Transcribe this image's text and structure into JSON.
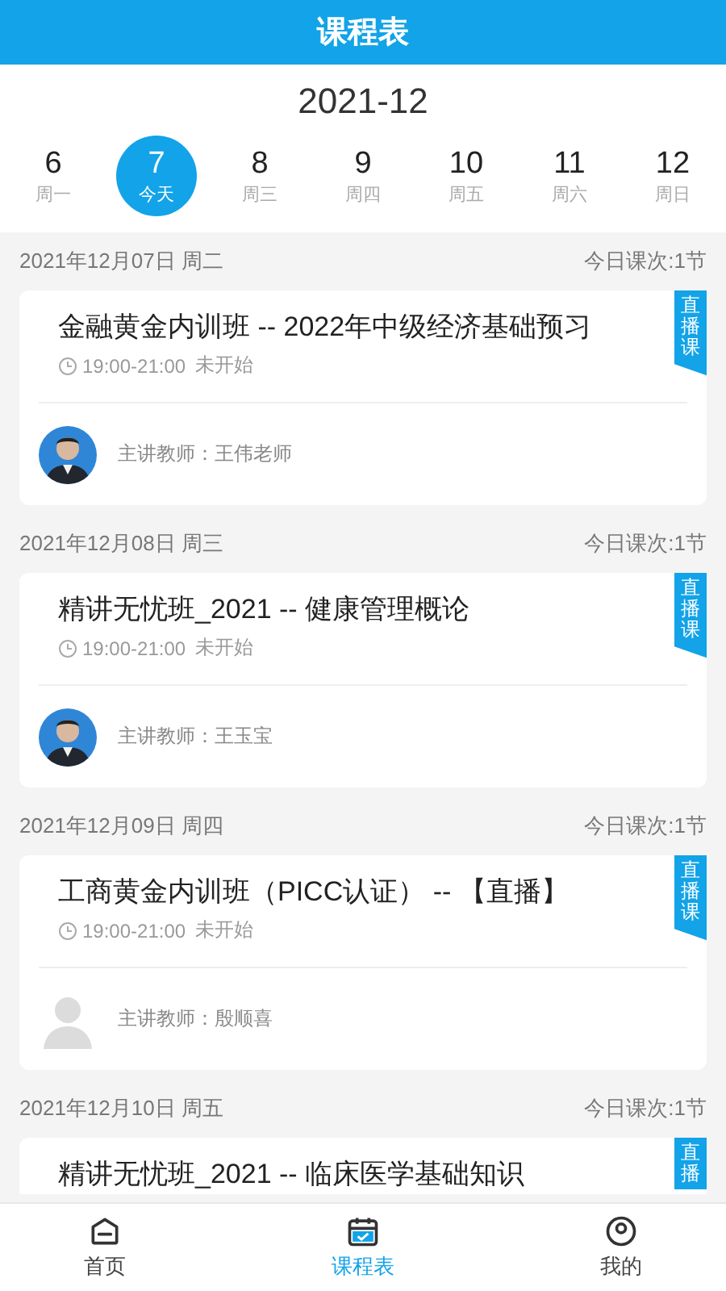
{
  "header": {
    "title": "课程表"
  },
  "calendar": {
    "month": "2021-12",
    "days": [
      {
        "day": "6",
        "weekday": "周一",
        "selected": false
      },
      {
        "day": "7",
        "weekday": "今天",
        "selected": true
      },
      {
        "day": "8",
        "weekday": "周三",
        "selected": false
      },
      {
        "day": "9",
        "weekday": "周四",
        "selected": false
      },
      {
        "day": "10",
        "weekday": "周五",
        "selected": false
      },
      {
        "day": "11",
        "weekday": "周六",
        "selected": false
      },
      {
        "day": "12",
        "weekday": "周日",
        "selected": false
      }
    ]
  },
  "sections": [
    {
      "date": "2021年12月07日 周二",
      "count": "今日课次:1节",
      "courses": [
        {
          "title": "金融黄金内训班 -- 2022年中级经济基础预习",
          "time": "19:00-21:00",
          "status": "未开始",
          "badge": "直播课",
          "teacher": "主讲教师：王伟老师"
        }
      ]
    },
    {
      "date": "2021年12月08日 周三",
      "count": "今日课次:1节",
      "courses": [
        {
          "title": "精讲无忧班_2021 -- 健康管理概论",
          "time": "19:00-21:00",
          "status": "未开始",
          "badge": "直播课",
          "teacher": "主讲教师：王玉宝"
        }
      ]
    },
    {
      "date": "2021年12月09日 周四",
      "count": "今日课次:1节",
      "courses": [
        {
          "title": "工商黄金内训班（PICC认证） -- 【直播】",
          "time": "19:00-21:00",
          "status": "未开始",
          "badge": "直播课",
          "teacher": "主讲教师：殷顺喜",
          "avatar": {
            "kind": "placeholder"
          }
        }
      ]
    },
    {
      "date": "2021年12月10日 周五",
      "count": "今日课次:1节",
      "courses": [
        {
          "title": "精讲无忧班_2021 -- 临床医学基础知识",
          "badge": "直播"
        }
      ]
    }
  ],
  "tabbar": [
    {
      "label": "首页",
      "selected": false
    },
    {
      "label": "课程表",
      "selected": true
    },
    {
      "label": "我的",
      "selected": false
    }
  ]
}
